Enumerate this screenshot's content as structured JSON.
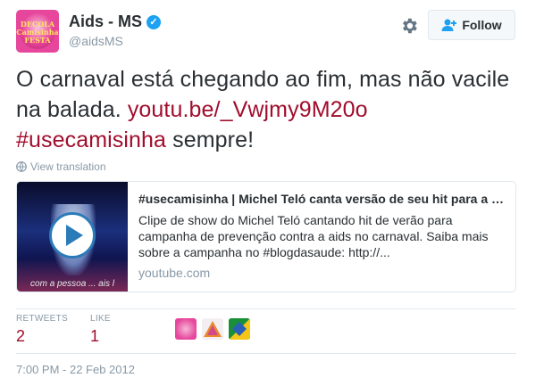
{
  "author": {
    "name": "Aids - MS",
    "handle": "@aidsMS",
    "avatar_text": "DECOLA Camisinha ENTRA NA FESTA"
  },
  "actions": {
    "follow_label": "Follow",
    "settings_icon": "gear-icon"
  },
  "tweet": {
    "text_part1": "O carnaval está chegando ao fim, mas não vacile na balada. ",
    "link": "youtu.be/_Vwjmy9M20o",
    "hashtag": "#usecamisinha",
    "text_part2": " sempre!",
    "translate_label": "View translation"
  },
  "card": {
    "title": "#usecamisinha | Michel Teló canta versão de seu hit para a campanha...",
    "description": "Clipe de show do Michel Teló cantando hit de verão para campanha de prevenção contra a aids no carnaval. Saiba mais sobre a campanha no #blogdasaude: http://...",
    "domain": "youtube.com",
    "thumb_caption": "com a pessoa ... ais l"
  },
  "stats": {
    "retweets_label": "RETWEETS",
    "retweets_count": "2",
    "likes_label": "LIKE",
    "likes_count": "1"
  },
  "timestamp": "7:00 PM - 22 Feb 2012",
  "colors": {
    "link": "#a10d2c",
    "muted": "#8899a6",
    "text": "#292f33",
    "play_button": "#2b7bb9"
  }
}
